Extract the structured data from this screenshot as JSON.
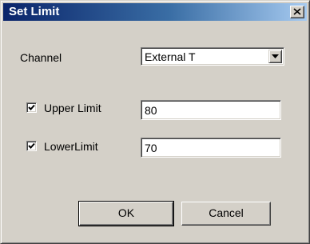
{
  "window": {
    "title": "Set Limit"
  },
  "channel": {
    "label": "Channel",
    "selected": "External T"
  },
  "upper": {
    "label": "Upper Limit",
    "checked": true,
    "value": "80"
  },
  "lower": {
    "label": "LowerLimit",
    "checked": true,
    "value": "70"
  },
  "buttons": {
    "ok": "OK",
    "cancel": "Cancel"
  },
  "icons": {
    "close": "close-icon",
    "dropdown": "chevron-down-icon",
    "check": "checkmark-icon"
  }
}
